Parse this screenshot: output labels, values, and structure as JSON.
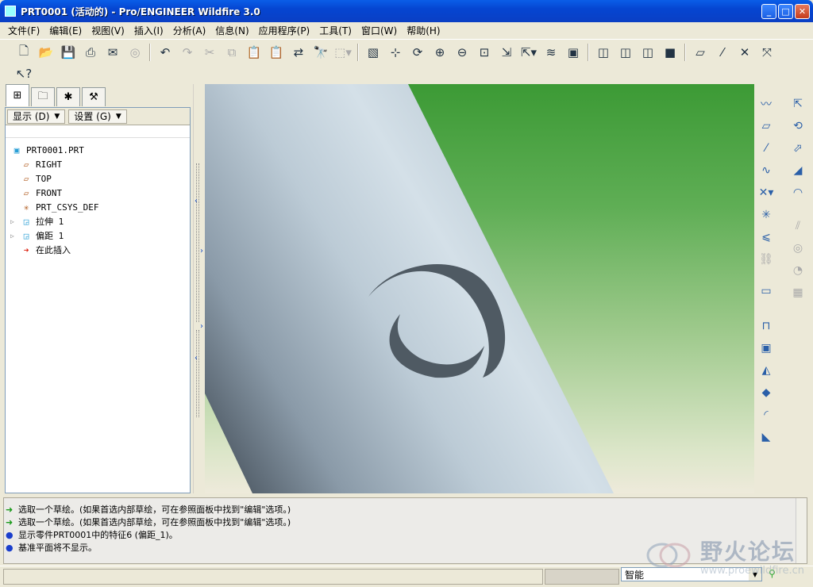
{
  "window": {
    "title": "PRT0001 (活动的) - Pro/ENGINEER Wildfire 3.0"
  },
  "menu": [
    "文件(F)",
    "编辑(E)",
    "视图(V)",
    "插入(I)",
    "分析(A)",
    "信息(N)",
    "应用程序(P)",
    "工具(T)",
    "窗口(W)",
    "帮助(H)"
  ],
  "toolbar": {
    "icons": [
      "new-icon",
      "open-icon",
      "save-icon",
      "print-icon",
      "send-icon",
      "disabled-icon",
      "undo-icon",
      "redo-icon",
      "cut-icon",
      "copy-icon",
      "paste-icon",
      "paste-special-icon",
      "regenerate-icon",
      "find-icon",
      "select-box-icon",
      "repaint-icon",
      "spin-center-icon",
      "orient-icon",
      "zoom-in-icon",
      "zoom-out-icon",
      "refit-icon",
      "reorient-icon",
      "saved-views-icon",
      "layers-icon",
      "view-manager-icon",
      "wireframe-icon",
      "hidden-line-icon",
      "no-hidden-icon",
      "shading-icon",
      "datum-planes-icon",
      "datum-axes-icon",
      "datum-points-icon",
      "coordinate-systems-icon"
    ],
    "context_help_icon": "whats-this-icon"
  },
  "model_tree": {
    "show_button": "显示 (D)",
    "settings_button": "设置 (G)",
    "nodes": [
      {
        "label": "PRT0001.PRT",
        "icon": "part-icon",
        "depth": 0
      },
      {
        "label": "RIGHT",
        "icon": "datum-plane-icon",
        "depth": 1
      },
      {
        "label": "TOP",
        "icon": "datum-plane-icon",
        "depth": 1
      },
      {
        "label": "FRONT",
        "icon": "datum-plane-icon",
        "depth": 1
      },
      {
        "label": "PRT_CSYS_DEF",
        "icon": "csys-icon",
        "depth": 1
      },
      {
        "label": "拉伸 1",
        "icon": "extrude-icon",
        "depth": 1,
        "expandable": true
      },
      {
        "label": "偏距 1",
        "icon": "offset-icon",
        "depth": 1,
        "expandable": true
      },
      {
        "label": "在此插入",
        "icon": "insert-arrow-icon",
        "depth": 1
      }
    ]
  },
  "messages": [
    {
      "icon": "prompt-arrow-icon",
      "text": "选取一个草绘。(如果首选内部草绘，可在参照面板中找到\"编辑\"选项。)"
    },
    {
      "icon": "prompt-arrow-icon",
      "text": "选取一个草绘。(如果首选内部草绘，可在参照面板中找到\"编辑\"选项。)"
    },
    {
      "icon": "info-dot-icon",
      "text": "显示零件PRT0001中的特征6 (偏距_1)。"
    },
    {
      "icon": "info-dot-icon",
      "text": "基准平面将不显示。"
    }
  ],
  "status": {
    "filter_value": "智能"
  },
  "watermark": {
    "text": "野火论坛",
    "url": "www.proewildfire.cn"
  },
  "colors": {
    "titlebar": "#0545d1",
    "viewport_top": "#3c9a35",
    "part": "#c4d4df",
    "accent": "#2a5fa8"
  }
}
